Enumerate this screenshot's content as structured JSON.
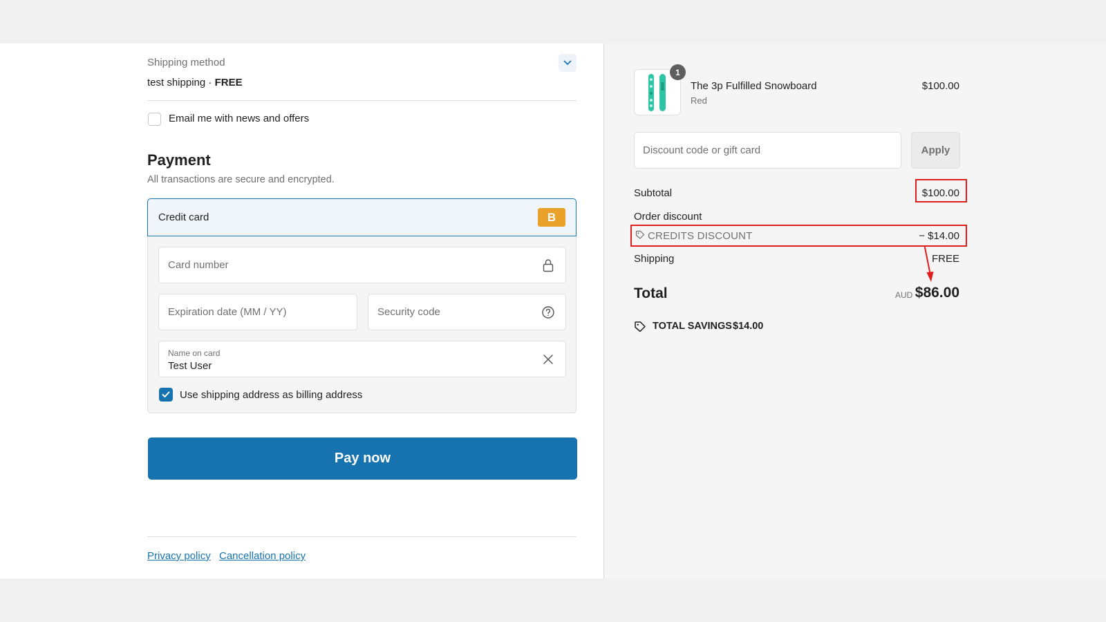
{
  "shipping": {
    "label": "Shipping method",
    "method": "test shipping",
    "separator": "·",
    "price": "FREE"
  },
  "newsletter": {
    "label": "Email me with news and offers",
    "checked": false
  },
  "payment": {
    "title": "Payment",
    "subtitle": "All transactions are secure and encrypted.",
    "method_label": "Credit card",
    "badge": "B",
    "card_number_placeholder": "Card number",
    "expiry_placeholder": "Expiration date (MM / YY)",
    "security_placeholder": "Security code",
    "name_label": "Name on card",
    "name_value": "Test User",
    "billing_label": "Use shipping address as billing address",
    "billing_checked": true,
    "pay_button": "Pay now"
  },
  "footer": {
    "privacy": "Privacy policy",
    "cancellation": "Cancellation policy"
  },
  "order": {
    "quantity": "1",
    "product_name": "The 3p Fulfilled Snowboard",
    "variant": "Red",
    "price": "$100.00",
    "discount_placeholder": "Discount code or gift card",
    "apply_button": "Apply",
    "subtotal_label": "Subtotal",
    "subtotal_value": "$100.00",
    "order_discount_label": "Order discount",
    "credits_label": "CREDITS DISCOUNT",
    "credits_value": "− $14.00",
    "shipping_label": "Shipping",
    "shipping_value": "FREE",
    "total_label": "Total",
    "currency": "AUD",
    "total_value": "$86.00",
    "savings_label": "TOTAL SAVINGS",
    "savings_value": "$14.00"
  },
  "colors": {
    "accent": "#1773b0",
    "highlight": "#e01c1c",
    "badge": "#e9a12a",
    "product": "#2fc4a4"
  },
  "icons": {
    "ship_toggle": "chevron-down-icon",
    "card_lock": "lock-icon",
    "security_help": "question-circle-icon",
    "name_clear": "close-icon",
    "billing_check": "check-icon",
    "discount_tag": "tag-icon",
    "savings_tag": "tag-icon"
  }
}
